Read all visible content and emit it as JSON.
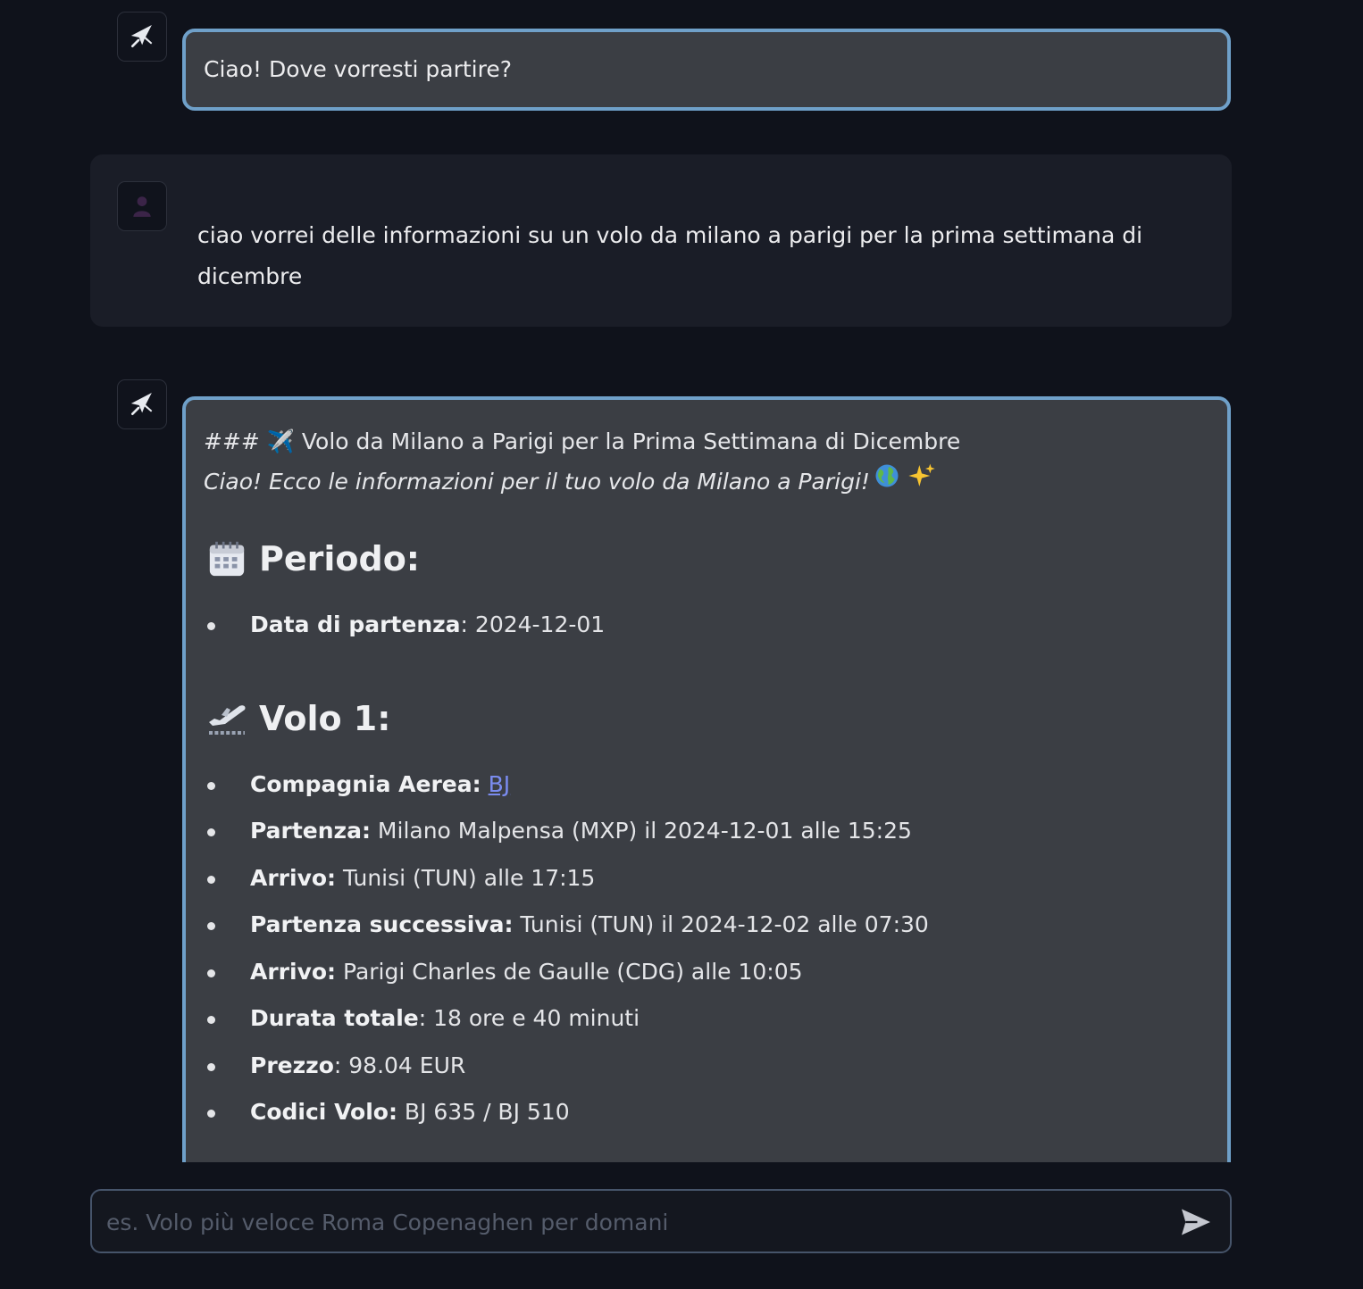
{
  "messages": {
    "assistant_greeting": "Ciao! Dove vorresti partire?",
    "user_query": "ciao vorrei delle informazioni su un volo da milano a parigi per la prima settimana di dicembre",
    "assistant_reply": {
      "raw_heading": "### ✈️ Volo da Milano a Parigi per la Prima Settimana di Dicembre",
      "intro": "Ciao! Ecco le informazioni per il tuo volo da Milano a Parigi!",
      "period_heading": "Periodo:",
      "period_items": [
        {
          "label": "Data di partenza",
          "value": ": 2024-12-01"
        }
      ],
      "flight_heading": "Volo 1:",
      "flight_items": [
        {
          "label": "Compagnia Aerea:",
          "value": "BJ"
        },
        {
          "label": "Partenza:",
          "value": " Milano Malpensa (MXP) il 2024-12-01 alle 15:25"
        },
        {
          "label": "Arrivo:",
          "value": " Tunisi (TUN) alle 17:15"
        },
        {
          "label": "Partenza successiva:",
          "value": " Tunisi (TUN) il 2024-12-02 alle 07:30"
        },
        {
          "label": "Arrivo:",
          "value": " Parigi Charles de Gaulle (CDG) alle 10:05"
        },
        {
          "label": "Durata totale",
          "value": ": 18 ore e 40 minuti"
        },
        {
          "label": "Prezzo",
          "value": ": 98.04 EUR"
        },
        {
          "label": "Codici Volo:",
          "value": " BJ 635 / BJ 510"
        }
      ]
    }
  },
  "composer": {
    "placeholder": "es. Volo più veloce Roma Copenaghen per domani",
    "value": ""
  },
  "icons": {
    "assistant_avatar": "airplane-icon",
    "user_avatar": "user-silhouette-icon",
    "send": "send-arrow-icon",
    "calendar": "calendar-icon",
    "departure": "airplane-departure-icon",
    "globe": "globe-icon",
    "sparkles": "sparkles-icon"
  },
  "colors": {
    "background": "#0f121b",
    "assistant_bubble": "#3b3e44",
    "assistant_border": "#6fa0c9",
    "user_row": "#1a1d27",
    "link": "#7b8cf0"
  }
}
